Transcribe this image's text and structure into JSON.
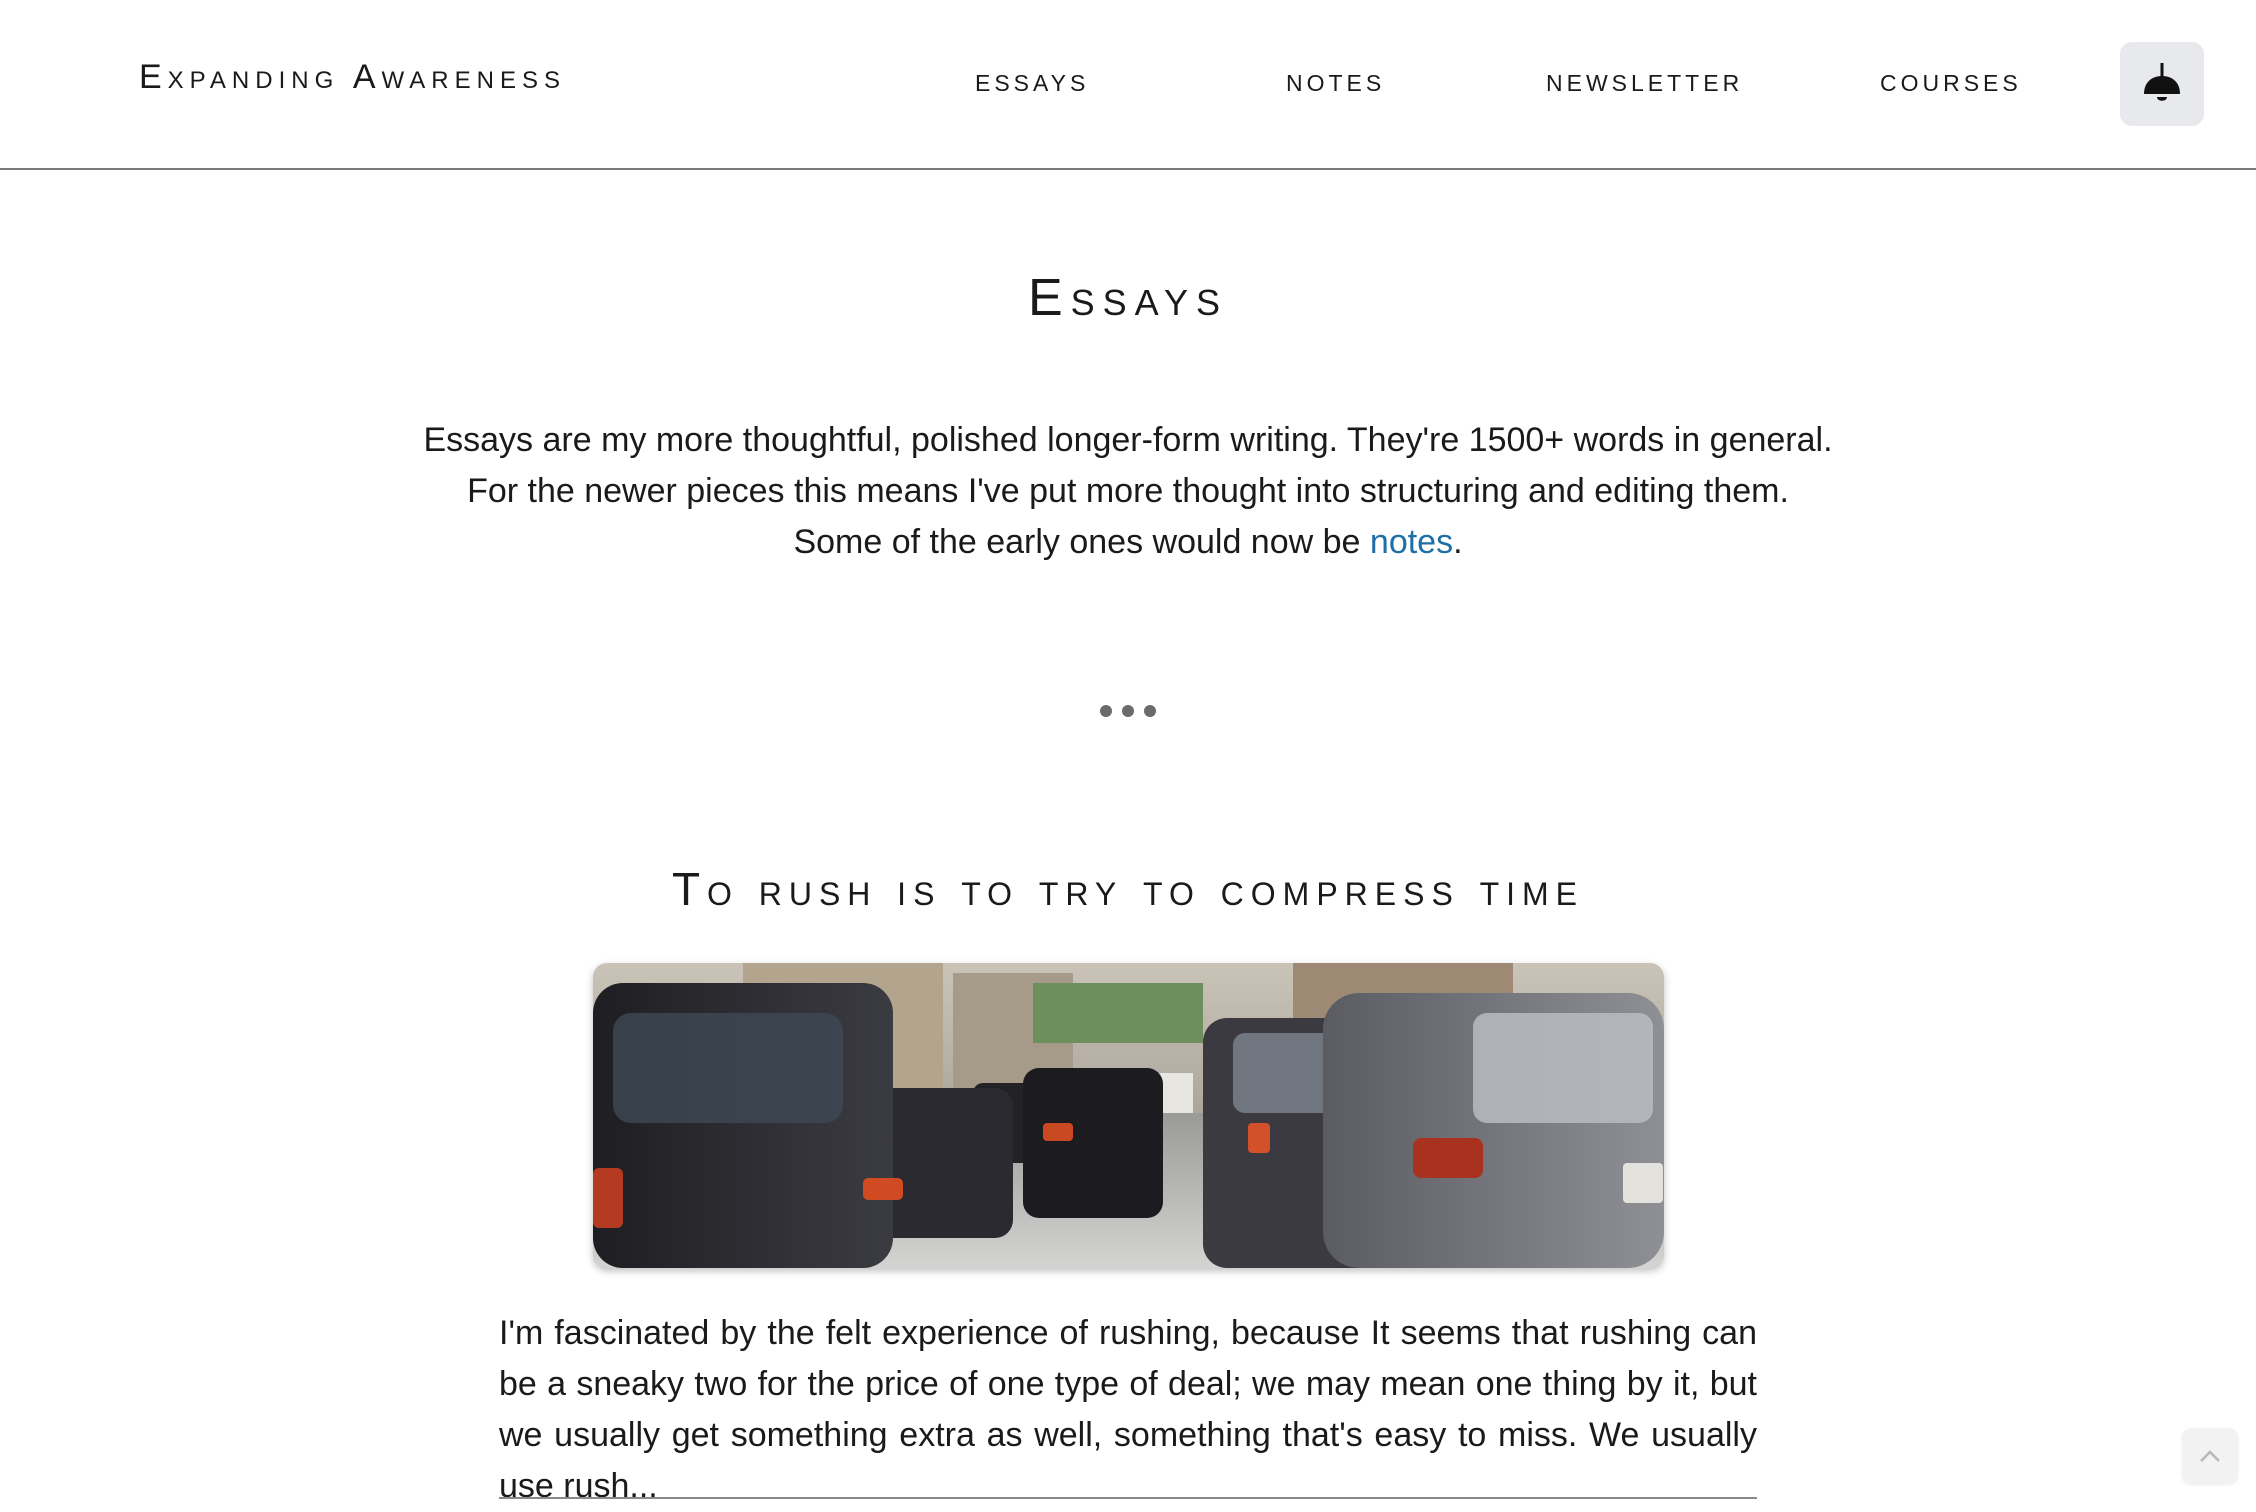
{
  "header": {
    "site_title": "Expanding Awareness",
    "nav": [
      {
        "label": "ESSAYS"
      },
      {
        "label": "NOTES"
      },
      {
        "label": "NEWSLETTER"
      },
      {
        "label": "COURSES"
      }
    ],
    "theme_toggle_icon": "lamp-icon"
  },
  "main": {
    "heading": "Essays",
    "intro_line1": "Essays are my more thoughtful, polished longer-form writing. They're 1500+ words in general.",
    "intro_line2": "For the newer pieces this means I've put more thought into structuring and editing them.",
    "intro_line3_prefix": "Some of the early ones would now be ",
    "intro_link": "notes",
    "intro_line3_suffix": ".",
    "link_color": "#1d6fa5"
  },
  "article": {
    "title": "To rush is to try to compress time",
    "image_alt": "traffic-street-photo",
    "excerpt": "I'm fascinated by the felt experience of rushing, because It seems that rushing can be a sneaky two for the price of one type of deal; we may mean one thing by it, but we usually get something extra as well, something that's easy to miss. We usually use rush..."
  },
  "widgets": {
    "back_to_top_icon": "chevron-up-icon"
  }
}
